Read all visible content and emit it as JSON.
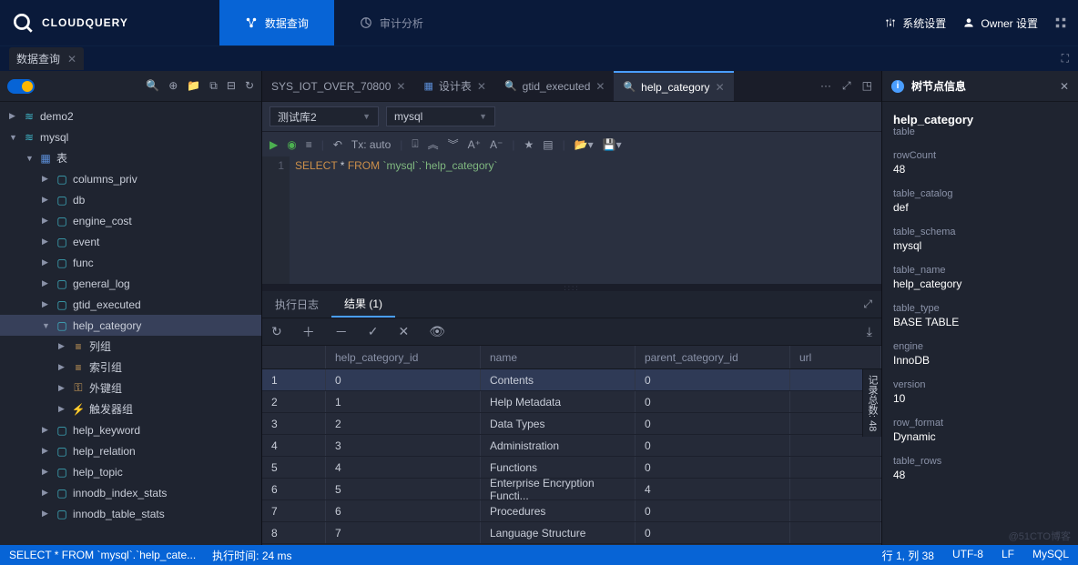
{
  "brand": "CLOUDQUERY",
  "topnav": {
    "tabs": [
      {
        "label": "数据查询",
        "active": true
      },
      {
        "label": "审计分析",
        "active": false
      }
    ],
    "right": [
      {
        "label": "系统设置",
        "icon": "sliders-icon"
      },
      {
        "label": "Owner 设置",
        "icon": "user-icon"
      }
    ]
  },
  "subtab": {
    "label": "数据查询"
  },
  "sidebar": {
    "tree": [
      {
        "depth": 0,
        "arrow": "▶",
        "icon": "db",
        "label": "demo2"
      },
      {
        "depth": 0,
        "arrow": "▼",
        "icon": "db",
        "label": "mysql"
      },
      {
        "depth": 1,
        "arrow": "▼",
        "icon": "table-group",
        "label": "表"
      },
      {
        "depth": 2,
        "arrow": "▶",
        "icon": "table",
        "label": "columns_priv"
      },
      {
        "depth": 2,
        "arrow": "▶",
        "icon": "table",
        "label": "db"
      },
      {
        "depth": 2,
        "arrow": "▶",
        "icon": "table",
        "label": "engine_cost"
      },
      {
        "depth": 2,
        "arrow": "▶",
        "icon": "table",
        "label": "event"
      },
      {
        "depth": 2,
        "arrow": "▶",
        "icon": "table",
        "label": "func"
      },
      {
        "depth": 2,
        "arrow": "▶",
        "icon": "table",
        "label": "general_log"
      },
      {
        "depth": 2,
        "arrow": "▶",
        "icon": "table",
        "label": "gtid_executed"
      },
      {
        "depth": 2,
        "arrow": "▼",
        "icon": "table",
        "label": "help_category",
        "selected": true
      },
      {
        "depth": 3,
        "arrow": "▶",
        "icon": "cols",
        "label": "列组"
      },
      {
        "depth": 3,
        "arrow": "▶",
        "icon": "cols",
        "label": "索引组"
      },
      {
        "depth": 3,
        "arrow": "▶",
        "icon": "key",
        "label": "外键组"
      },
      {
        "depth": 3,
        "arrow": "▶",
        "icon": "trigger",
        "label": "触发器组"
      },
      {
        "depth": 2,
        "arrow": "▶",
        "icon": "table",
        "label": "help_keyword"
      },
      {
        "depth": 2,
        "arrow": "▶",
        "icon": "table",
        "label": "help_relation"
      },
      {
        "depth": 2,
        "arrow": "▶",
        "icon": "table",
        "label": "help_topic"
      },
      {
        "depth": 2,
        "arrow": "▶",
        "icon": "table",
        "label": "innodb_index_stats"
      },
      {
        "depth": 2,
        "arrow": "▶",
        "icon": "table",
        "label": "innodb_table_stats"
      }
    ]
  },
  "editorTabs": [
    {
      "label": "SYS_IOT_OVER_70800",
      "icon": "table",
      "active": false
    },
    {
      "label": "设计表",
      "icon": "design",
      "active": false
    },
    {
      "label": "gtid_executed",
      "icon": "search",
      "active": false
    },
    {
      "label": "help_category",
      "icon": "search",
      "active": true
    }
  ],
  "editorMore": "···",
  "selectors": {
    "db": "测试库2",
    "schema": "mysql"
  },
  "txLabel": "Tx: auto",
  "editor": {
    "lineNo": "1",
    "sql_kw1": "SELECT",
    "sql_mid": " * ",
    "sql_kw2": "FROM",
    "sql_rest": " `mysql`.`help_category`"
  },
  "resultTabs": {
    "log": "执行日志",
    "result": "结果 (1)"
  },
  "grid": {
    "columns": [
      "",
      "help_category_id",
      "name",
      "parent_category_id",
      "url"
    ],
    "rows": [
      [
        "1",
        "0",
        "Contents",
        "0",
        ""
      ],
      [
        "2",
        "1",
        "Help Metadata",
        "0",
        ""
      ],
      [
        "3",
        "2",
        "Data Types",
        "0",
        ""
      ],
      [
        "4",
        "3",
        "Administration",
        "0",
        ""
      ],
      [
        "5",
        "4",
        "Functions",
        "0",
        ""
      ],
      [
        "6",
        "5",
        "Enterprise Encryption Functi...",
        "4",
        ""
      ],
      [
        "7",
        "6",
        "Procedures",
        "0",
        ""
      ],
      [
        "8",
        "7",
        "Language Structure",
        "0",
        ""
      ]
    ],
    "totalBadge": "记录总数: 48"
  },
  "infoPanel": {
    "title": "树节点信息",
    "name": "help_category",
    "sub": "table",
    "fields": [
      {
        "k": "rowCount",
        "v": "48"
      },
      {
        "k": "table_catalog",
        "v": "def"
      },
      {
        "k": "table_schema",
        "v": "mysql"
      },
      {
        "k": "table_name",
        "v": "help_category"
      },
      {
        "k": "table_type",
        "v": "BASE TABLE"
      },
      {
        "k": "engine",
        "v": "InnoDB"
      },
      {
        "k": "version",
        "v": "10"
      },
      {
        "k": "row_format",
        "v": "Dynamic"
      },
      {
        "k": "table_rows",
        "v": "48"
      }
    ]
  },
  "status": {
    "sql": "SELECT * FROM `mysql`.`help_cate...",
    "time": "执行时间:  24 ms",
    "pos": "行 1, 列 38",
    "enc": "UTF-8",
    "lf": "LF",
    "dialect": "MySQL"
  },
  "watermark": "@51CTO博客"
}
